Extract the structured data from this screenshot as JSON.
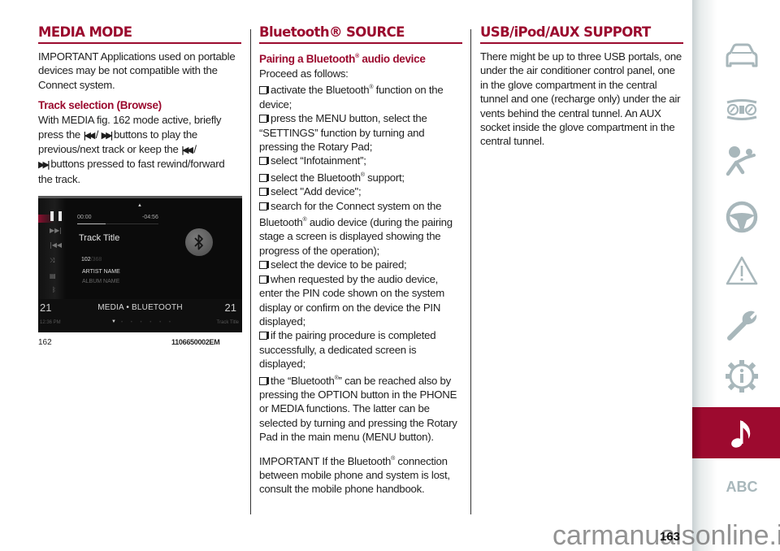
{
  "columns": {
    "media_mode": {
      "heading": "MEDIA MODE",
      "important": "IMPORTANT Applications used on portable devices may be not compatible with the Connect system.",
      "subheading": "Track selection (Browse)",
      "body": {
        "part1": "With MEDIA fig. 162 mode active, briefly press the ",
        "sep1": " / ",
        "part2": " buttons to play the previous/next track or keep the ",
        "sep2": " / ",
        "part3": " buttons pressed to fast rewind/forward the track."
      },
      "figure": {
        "number": "162",
        "code": "1106650002EM",
        "screen": {
          "time_elapsed": "00:00",
          "time_remaining": "-04:56",
          "progress_fraction": 0.35,
          "track_title": "Track Title",
          "track_number": "102",
          "track_total": "/368",
          "artist": "ARTIST NAME",
          "album": "ALBUM NAME",
          "channel_left": "21",
          "channel_right": "21",
          "source": "MEDIA • BLUETOOTH",
          "clock": "12:36 PM",
          "track_title_small": "Track Title"
        }
      }
    },
    "bluetooth_source": {
      "heading": "Bluetooth® SOURCE",
      "subheading_pre": "Pairing a Bluetooth",
      "subheading_post": " audio device",
      "reg": "®",
      "intro": "Proceed as follows:",
      "steps": [
        {
          "pre": "activate the Bluetooth",
          "reg": "®",
          "post": " function on the device;"
        },
        {
          "pre": "press the MENU button, select the “SETTINGS” function by turning and pressing the Rotary Pad;",
          "reg": "",
          "post": ""
        },
        {
          "pre": "select “Infotainment”;",
          "reg": "",
          "post": ""
        },
        {
          "pre": "select the Bluetooth",
          "reg": "®",
          "post": " support;"
        },
        {
          "pre": "select \"Add device\";",
          "reg": "",
          "post": ""
        },
        {
          "pre": "search for the Connect system on the Bluetooth",
          "reg": "®",
          "post": " audio device (during the pairing stage a screen is displayed showing the progress of the operation);"
        },
        {
          "pre": "select the device to be paired;",
          "reg": "",
          "post": ""
        },
        {
          "pre": "when requested by the audio device, enter the PIN code shown on the system display or confirm on the device the PIN displayed;",
          "reg": "",
          "post": ""
        },
        {
          "pre": "if the pairing procedure is completed successfully, a dedicated screen is displayed;",
          "reg": "",
          "post": ""
        },
        {
          "pre": "the “Bluetooth",
          "reg": "®",
          "post": "” can be reached also by pressing the OPTION button in the PHONE or MEDIA functions. The latter can be selected by turning and pressing the Rotary Pad in the main menu (MENU button)."
        }
      ],
      "important_pre": "IMPORTANT If the Bluetooth",
      "important_reg": "®",
      "important_post": " connection between mobile phone and system is lost, consult the mobile phone handbook."
    },
    "usb_support": {
      "heading": "USB/iPod/AUX SUPPORT",
      "body": "There might be up to three USB portals, one under the air conditioner control panel, one in the glove compartment in the central tunnel and one (recharge only) under the air vents behind the central tunnel. An AUX socket inside the glove compartment in the central tunnel."
    }
  },
  "nav": {
    "items": [
      {
        "name": "car",
        "icon": "car-icon"
      },
      {
        "name": "dashboard",
        "icon": "instrument-panel-icon"
      },
      {
        "name": "safety",
        "icon": "airbag-icon"
      },
      {
        "name": "driving",
        "icon": "steering-wheel-icon"
      },
      {
        "name": "emergency",
        "icon": "warning-triangle-icon"
      },
      {
        "name": "maintenance",
        "icon": "wrench-icon"
      },
      {
        "name": "technical-data",
        "icon": "gear-info-icon"
      },
      {
        "name": "multimedia",
        "icon": "music-note-icon",
        "active": true
      },
      {
        "name": "index",
        "icon": "abc-index",
        "label": "ABC"
      }
    ],
    "active_color": "#9d0a2f",
    "icon_color": "#a8b7bb"
  },
  "page_number": "163",
  "watermark": "carmanualsonline.info",
  "accent_color": "#9b0a2e"
}
